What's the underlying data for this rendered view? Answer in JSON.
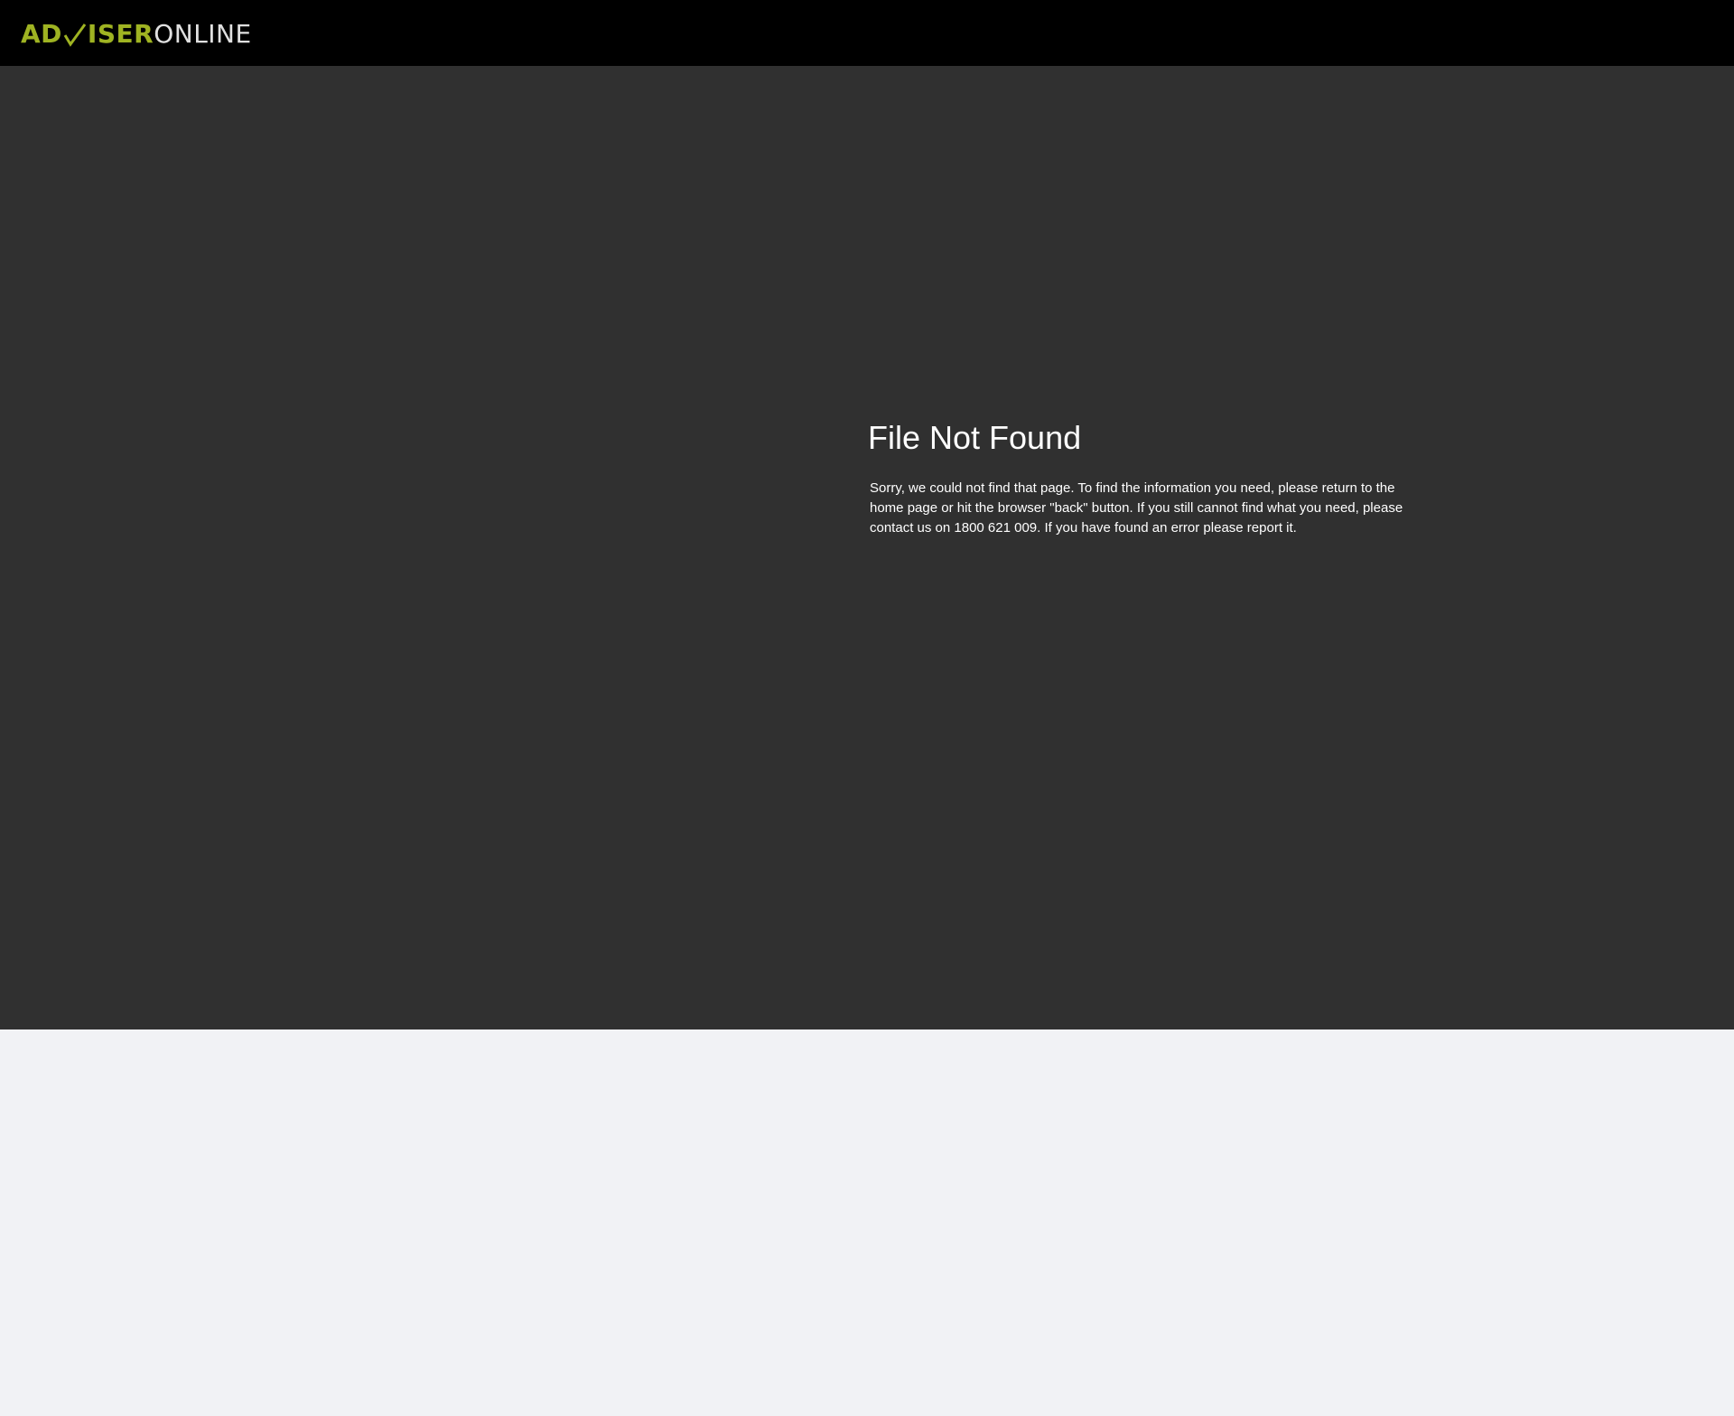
{
  "header": {
    "logo": {
      "part1": "AD",
      "part2": "ISER",
      "part3": "ONLINE",
      "brand_color": "#9fb322",
      "tick_icon": "checkmark-icon"
    }
  },
  "main": {
    "title": "File Not Found",
    "message": "Sorry, we could not find that page. To find the information you need, please return to the home page or hit the browser \"back\" button. If you still cannot find what you need, please contact us on 1800 621 009. If you have found an error please report it."
  },
  "colors": {
    "header_bg": "#000000",
    "hero_bg": "#303030",
    "page_bg": "#f1f2f5",
    "text": "#ffffff"
  }
}
